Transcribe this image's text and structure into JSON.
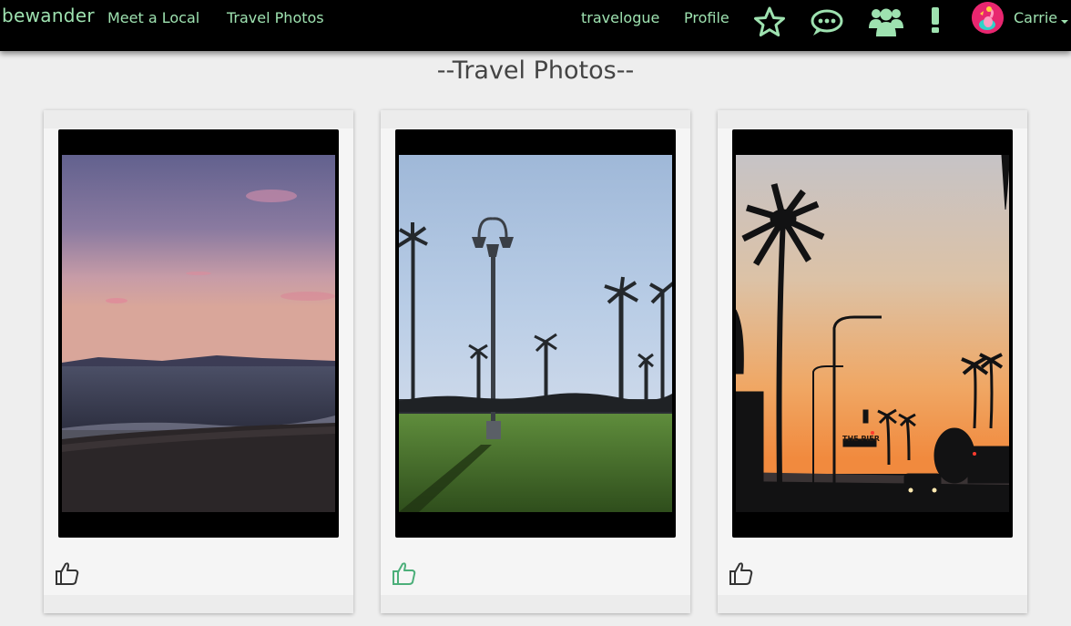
{
  "nav": {
    "brand": "bewander",
    "links": [
      "Meet a Local",
      "Travel Photos",
      "travelogue",
      "Profile"
    ],
    "icons": [
      "star-icon",
      "chat-bubble-icon",
      "group-icon",
      "alert-icon"
    ],
    "user_name": "Carrie"
  },
  "page": {
    "title": "--Travel Photos--"
  },
  "photos": [
    {
      "subject": "sunset over ocean beach",
      "liked": false
    },
    {
      "subject": "palm trees and street lamp in park",
      "liked": true
    },
    {
      "subject": "palm tree silhouettes at sunset near the pier",
      "liked": false,
      "sign_text": "THE PIER"
    }
  ],
  "colors": {
    "accent": "#9ee2b0",
    "like_active": "#4caf7a",
    "like_inactive": "#333333",
    "navbar_bg": "#000000",
    "page_bg": "#eeeeee"
  }
}
